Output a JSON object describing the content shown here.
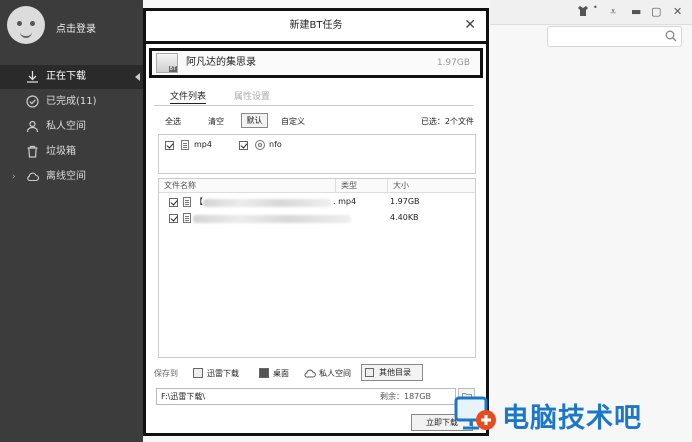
{
  "sidebar": {
    "login": "点击登录",
    "items": [
      {
        "label": "正在下载",
        "icon": "download-icon"
      },
      {
        "label": "已完成(11)",
        "icon": "check-circle-icon"
      },
      {
        "label": "私人空间",
        "icon": "person-icon"
      },
      {
        "label": "垃圾箱",
        "icon": "trash-icon"
      },
      {
        "label": "离线空间",
        "icon": "cloud-icon"
      }
    ]
  },
  "dialog": {
    "title": "新建BT任务",
    "close": "✕",
    "task": {
      "badge": "BT",
      "name": "阿凡达的集思录",
      "size": "1.97GB"
    },
    "tabs": [
      "文件列表",
      "属性设置"
    ],
    "select_buttons": [
      "全选",
      "清空",
      "默认",
      "自定义"
    ],
    "selected_info": "已选：2个文件",
    "filters": [
      "mp4",
      "nfo"
    ],
    "columns": [
      "文件名称",
      "类型",
      "大小"
    ],
    "files": [
      {
        "name_prefix": "【",
        "type": ". mp4",
        "size": "1.97GB"
      },
      {
        "name_prefix": "",
        "type": "",
        "size": "4.40KB"
      }
    ],
    "save": {
      "label": "保存到",
      "options": [
        "迅雷下载",
        "桌面",
        "私人空间",
        "其他目录"
      ],
      "path": "F:\\迅雷下载\\",
      "free": "剩余：187GB"
    },
    "download_button": "立即下载"
  },
  "watermark": "电脑技术吧",
  "colors": {
    "sidebar": "#3c3c3c",
    "watermark": "#1b78c8"
  }
}
